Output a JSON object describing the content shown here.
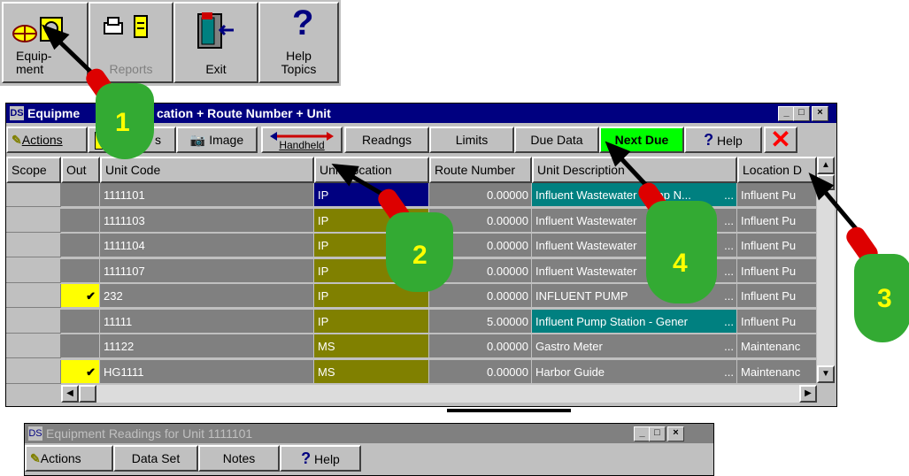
{
  "toolbar": {
    "equipment_label": "Equip-\nment",
    "reports_label": "Reports",
    "exit_label": "Exit",
    "help_label": "Help\nTopics"
  },
  "main_window": {
    "title": "Equipment - Location + Route Number + Unit",
    "title_visible_left": "Equipme",
    "title_visible_right": "cation + Route Number + Unit",
    "buttons": {
      "actions": "Actions",
      "reports": "s",
      "image": "Image",
      "handheld": "Handheld",
      "readings": "Readngs",
      "limits": "Limits",
      "due_date": "Due Data",
      "next_due": "Next Due",
      "help": "Help"
    },
    "columns": [
      "Scope",
      "Out",
      "Unit Code",
      "Unit Location",
      "Route Number",
      "Unit Description",
      "Location D"
    ],
    "rows": [
      {
        "out": false,
        "code": "1111101",
        "loc": "IP",
        "route": "0.00000",
        "desc": "Influent Wastewater Pump N...",
        "location": "Influent Pu"
      },
      {
        "out": false,
        "code": "1111103",
        "loc": "IP",
        "route": "0.00000",
        "desc": "Influent Wastewater",
        "location": "Influent Pu"
      },
      {
        "out": false,
        "code": "1111104",
        "loc": "IP",
        "route": "0.00000",
        "desc": "Influent Wastewater",
        "location": "Influent Pu"
      },
      {
        "out": false,
        "code": "1111107",
        "loc": "IP",
        "route": "0.00000",
        "desc": "Influent Wastewater",
        "location": "Influent Pu"
      },
      {
        "out": true,
        "code": "232",
        "loc": "IP",
        "route": "0.00000",
        "desc": "INFLUENT PUMP",
        "location": "Influent Pu"
      },
      {
        "out": false,
        "code": "11111",
        "loc": "IP",
        "route": "5.00000",
        "desc": "Influent Pump Station - Gener",
        "location": "Influent Pu"
      },
      {
        "out": false,
        "code": "11122",
        "loc": "MS",
        "route": "0.00000",
        "desc": "Gastro Meter",
        "location": "Maintenanc"
      },
      {
        "out": true,
        "code": "HG1111",
        "loc": "MS",
        "route": "0.00000",
        "desc": "Harbor Guide",
        "location": "Maintenanc"
      }
    ]
  },
  "readings_window": {
    "title": "Equipment Readings for Unit 1111101",
    "buttons": {
      "actions": "Actions",
      "data_set": "Data Set",
      "notes": "Notes",
      "help": "Help"
    }
  },
  "hands": [
    "1",
    "2",
    "3",
    "4"
  ],
  "colors": {
    "titlebar": "#000080",
    "next_due": "#00ff00",
    "close_x": "#ff0000",
    "hand": "#33aa33"
  }
}
